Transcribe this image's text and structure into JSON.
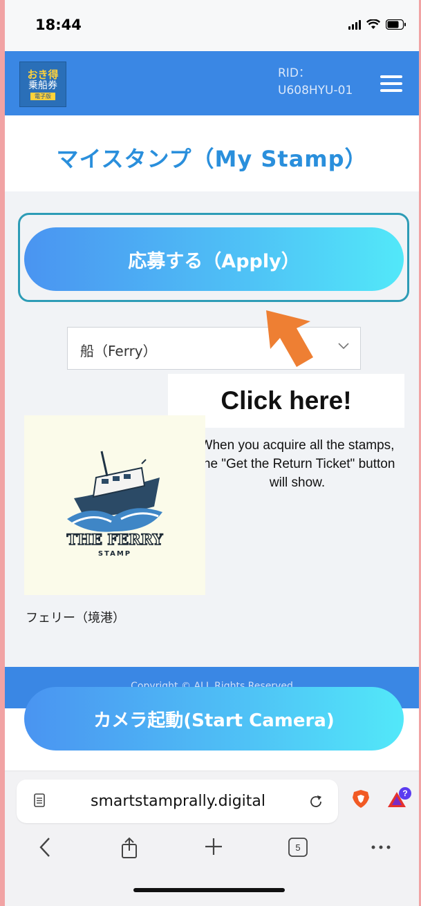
{
  "status_bar": {
    "time": "18:44"
  },
  "header": {
    "logo": {
      "line1": "おき得",
      "line2": "乗船券",
      "line3": "電子版"
    },
    "rid_label": "RID：",
    "rid_value": "U608HYU-01",
    "menu_icon": "hamburger-icon"
  },
  "page": {
    "title": "マイスタンプ（My Stamp）"
  },
  "apply_button": {
    "label": "応募する（Apply）"
  },
  "select": {
    "selected": "船（Ferry）",
    "icon": "chevron-down-icon"
  },
  "callout": {
    "heading": "Click here!",
    "note": "When you acquire all the stamps, the \"Get the Return Ticket\" button will show."
  },
  "stamp": {
    "image_text_1": "THE FERRY",
    "image_text_2": "STAMP",
    "caption": "フェリー（境港）"
  },
  "footer": {
    "copyright": "Copyright © ALL Rights Reserved"
  },
  "camera_button": {
    "label": "カメラ起動(Start Camera)"
  },
  "browser": {
    "url": "smartstamprally.digital",
    "tab_count": "5",
    "notification_badge": "?"
  },
  "colors": {
    "header_blue": "#3a87e4",
    "title_blue": "#2a8fdc",
    "arrow_orange": "#ee7f33",
    "outline_teal": "#2d9cb6"
  }
}
